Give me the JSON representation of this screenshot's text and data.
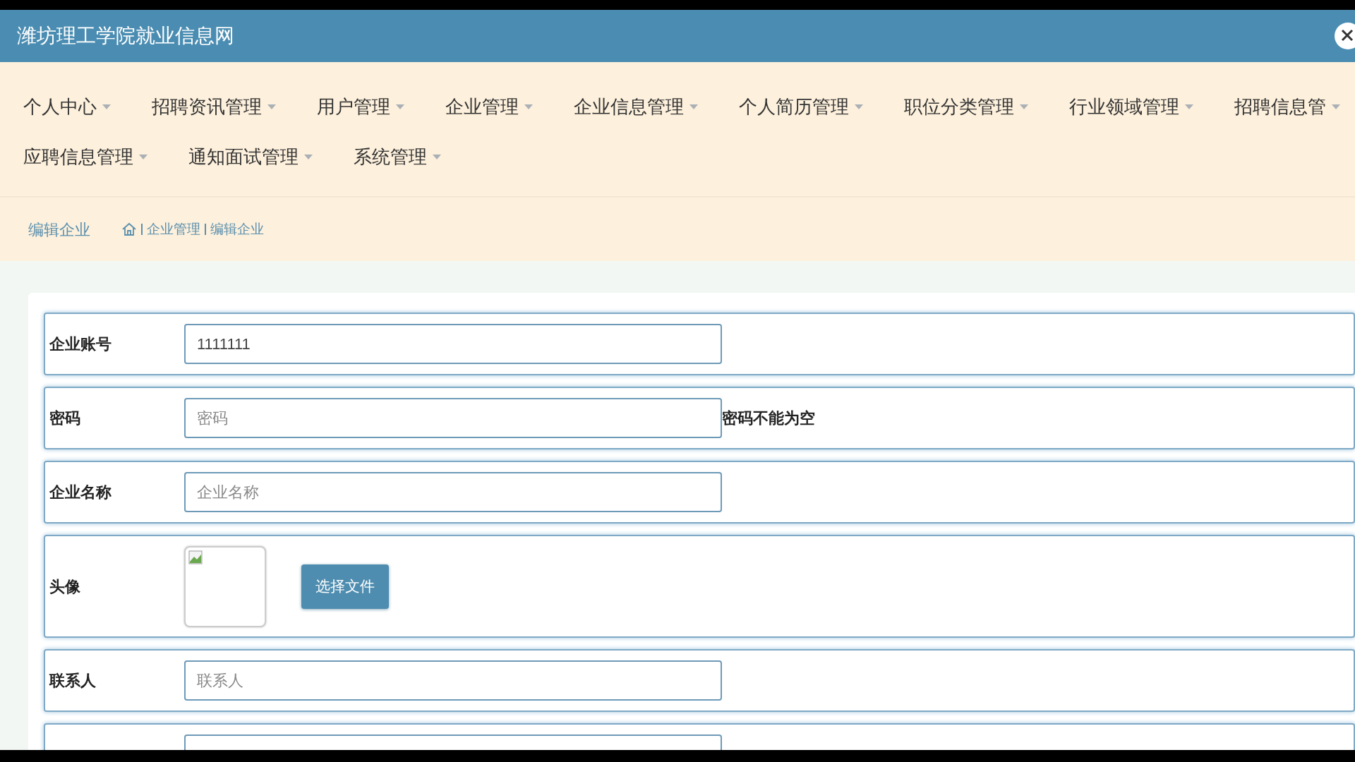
{
  "window": {
    "title": "潍坊理工学院就业信息网"
  },
  "nav": {
    "items": [
      {
        "label": "个人中心"
      },
      {
        "label": "招聘资讯管理"
      },
      {
        "label": "用户管理"
      },
      {
        "label": "企业管理"
      },
      {
        "label": "企业信息管理"
      },
      {
        "label": "个人简历管理"
      },
      {
        "label": "职位分类管理"
      },
      {
        "label": "行业领域管理"
      },
      {
        "label": "招聘信息管"
      },
      {
        "label": "应聘信息管理"
      },
      {
        "label": "通知面试管理"
      },
      {
        "label": "系统管理"
      }
    ]
  },
  "breadcrumb": {
    "page_title": "编辑企业",
    "trail": [
      "企业管理",
      "编辑企业"
    ]
  },
  "form": {
    "fields": [
      {
        "kind": "text",
        "label": "企业账号",
        "value": "1111111"
      },
      {
        "kind": "text",
        "label": "密码",
        "placeholder": "密码",
        "error": "密码不能为空"
      },
      {
        "kind": "text",
        "label": "企业名称",
        "placeholder": "企业名称"
      },
      {
        "kind": "image",
        "label": "头像",
        "button": "选择文件"
      },
      {
        "kind": "text",
        "label": "联系人",
        "placeholder": "联系人"
      },
      {
        "kind": "text"
      }
    ]
  }
}
